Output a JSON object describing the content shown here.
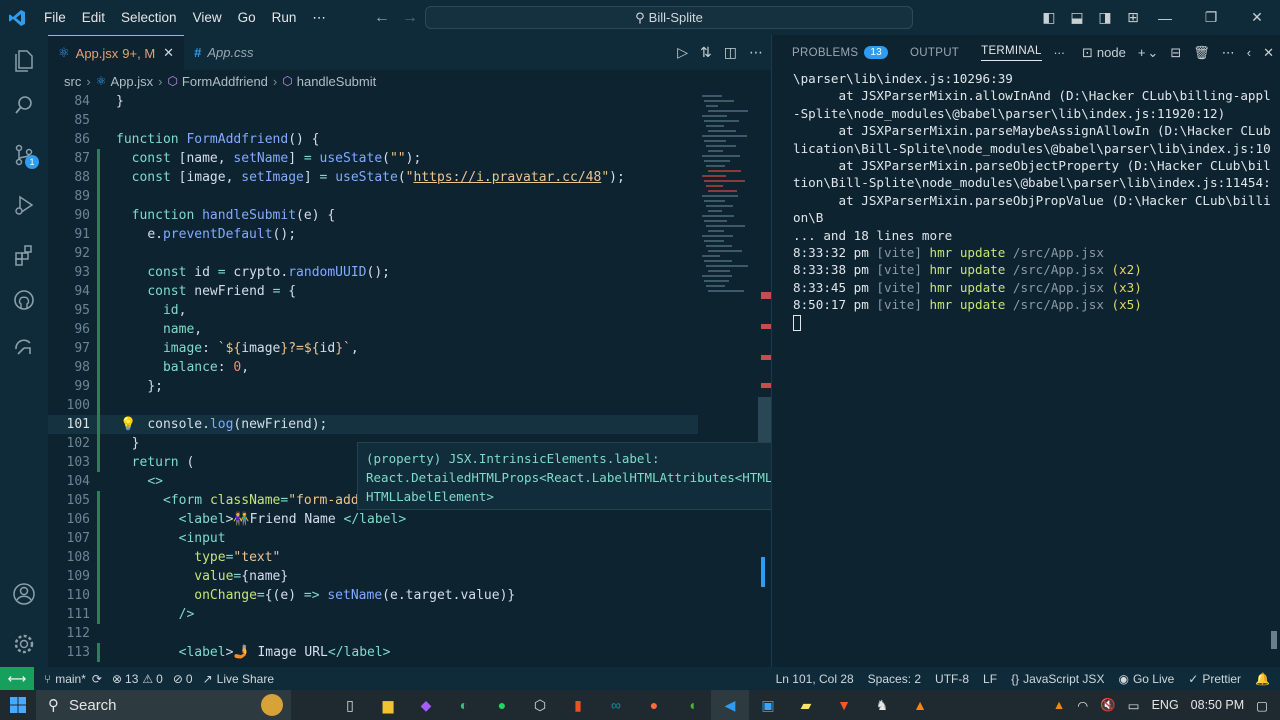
{
  "menu": [
    "File",
    "Edit",
    "Selection",
    "View",
    "Go",
    "Run",
    "⋯"
  ],
  "command_center": "Bill-Splite",
  "activity": {
    "source_control_badge": "1"
  },
  "tabs": [
    {
      "label": "App.jsx",
      "status": "9+, M"
    },
    {
      "label": "App.css"
    }
  ],
  "breadcrumb": [
    "src",
    "App.jsx",
    "FormAddfriend",
    "handleSubmit"
  ],
  "code_lines": [
    {
      "n": "84",
      "html": "<span class='punc'>}</span>"
    },
    {
      "n": "85",
      "html": ""
    },
    {
      "n": "86",
      "html": "<span class='kw'>function</span> <span class='fn'>FormAddfriend</span><span class='punc'>() {</span>"
    },
    {
      "n": "87",
      "html": "  <span class='kw'>const</span> <span class='punc'>[</span><span class='var'>name</span><span class='punc'>,</span> <span class='fn'>setName</span><span class='punc'>]</span> <span class='kw'>=</span> <span class='fn'>useState</span><span class='punc'>(</span><span class='str'>\"\"</span><span class='punc'>);</span>"
    },
    {
      "n": "88",
      "html": "  <span class='kw'>const</span> <span class='punc'>[</span><span class='var'>image</span><span class='punc'>,</span> <span class='fn'>setImage</span><span class='punc'>]</span> <span class='kw'>=</span> <span class='fn'>useState</span><span class='punc'>(</span><span class='str'>\"<u>https://i.pravatar.cc/48</u>\"</span><span class='punc'>);</span>"
    },
    {
      "n": "89",
      "html": ""
    },
    {
      "n": "90",
      "html": "  <span class='kw'>function</span> <span class='fn'>handleSubmit</span><span class='punc'>(</span><span class='var'>e</span><span class='punc'>) {</span>"
    },
    {
      "n": "91",
      "html": "    <span class='var'>e</span><span class='punc'>.</span><span class='fn'>preventDefault</span><span class='punc'>();</span>"
    },
    {
      "n": "92",
      "html": ""
    },
    {
      "n": "93",
      "html": "    <span class='kw'>const</span> <span class='var'>id</span> <span class='kw'>=</span> <span class='var'>crypto</span><span class='punc'>.</span><span class='fn'>randomUUID</span><span class='punc'>();</span>"
    },
    {
      "n": "94",
      "html": "    <span class='kw'>const</span> <span class='var'>newFriend</span> <span class='kw'>=</span> <span class='punc'>{</span>"
    },
    {
      "n": "95",
      "html": "      <span class='prop'>id</span><span class='punc'>,</span>"
    },
    {
      "n": "96",
      "html": "      <span class='prop'>name</span><span class='punc'>,</span>"
    },
    {
      "n": "97",
      "html": "      <span class='prop'>image</span><span class='punc'>:</span> <span class='tmpl'>`${</span><span class='var'>image</span><span class='tmpl'>}?=${</span><span class='var'>id</span><span class='tmpl'>}`</span><span class='punc'>,</span>"
    },
    {
      "n": "98",
      "html": "      <span class='prop'>balance</span><span class='punc'>:</span> <span class='num'>0</span><span class='punc'>,</span>"
    },
    {
      "n": "99",
      "html": "    <span class='punc'>};</span>"
    },
    {
      "n": "100",
      "html": ""
    },
    {
      "n": "101",
      "html": "    <span class='var'>console</span><span class='punc'>.</span><span class='fn'>log</span><span class='punc'>(</span><span class='var'>newFriend</span><span class='punc'>);</span>"
    },
    {
      "n": "102",
      "html": "  <span class='punc'>}</span>"
    },
    {
      "n": "103",
      "html": "  <span class='kw'>return</span> <span class='punc'>(</span>"
    },
    {
      "n": "104",
      "html": "    <span class='tag'>&lt;&gt;</span>"
    },
    {
      "n": "105",
      "html": "      <span class='tag'>&lt;form</span> <span class='attr'>className</span><span class='kw'>=</span><span class='str'>\"form-add</span>"
    },
    {
      "n": "106",
      "html": "        <span class='tag'>&lt;label</span><span class='punc'>&gt;</span>👫<span class='var'>Friend Name </span><span class='tag'>&lt;/label&gt;</span>"
    },
    {
      "n": "107",
      "html": "        <span class='tag'>&lt;input</span>"
    },
    {
      "n": "108",
      "html": "          <span class='attr'>type</span><span class='kw'>=</span><span class='str'>\"text\"</span>"
    },
    {
      "n": "109",
      "html": "          <span class='attr'>value</span><span class='kw'>=</span><span class='punc'>{</span><span class='var'>name</span><span class='punc'>}</span>"
    },
    {
      "n": "110",
      "html": "          <span class='attr'>onChange</span><span class='kw'>=</span><span class='punc'>{(</span><span class='var'>e</span><span class='punc'>)</span> <span class='kw'>=&gt;</span> <span class='fn'>setName</span><span class='punc'>(</span><span class='var'>e</span><span class='punc'>.</span><span class='var'>target</span><span class='punc'>.</span><span class='var'>value</span><span class='punc'>)}</span>"
    },
    {
      "n": "111",
      "html": "        <span class='tag'>/&gt;</span>"
    },
    {
      "n": "112",
      "html": ""
    },
    {
      "n": "113",
      "html": "        <span class='tag'>&lt;label</span><span class='punc'>&gt;</span>🤳 <span class='var'>Image URL</span><span class='tag'>&lt;/label&gt;</span>"
    }
  ],
  "hover": {
    "line1": "(property) JSX.IntrinsicElements.label:",
    "line2": "React.DetailedHTMLProps<React.LabelHTMLAttributes<HTMLLabelEleme",
    "line3": "HTMLLabelElement>"
  },
  "panel": {
    "tabs": [
      "PROBLEMS",
      "OUTPUT",
      "TERMINAL"
    ],
    "problems_count": "13",
    "terminal_name": "node"
  },
  "terminal_lines": [
    {
      "html": "\\parser\\lib\\index.js:10296:39"
    },
    {
      "html": "      at JSXParserMixin.allowInAnd (D:\\Hacker CLub\\billing-appl"
    },
    {
      "html": "-Splite\\node_modules\\@babel\\parser\\lib\\index.js:11920:12)"
    },
    {
      "html": "      at JSXParserMixin.parseMaybeAssignAllowIn (D:\\Hacker CLub"
    },
    {
      "html": "lication\\Bill-Splite\\node_modules\\@babel\\parser\\lib\\index.js:10"
    },
    {
      "html": "      at JSXParserMixin.parseObjectProperty (D:\\Hacker CLub\\bil"
    },
    {
      "html": "tion\\Bill-Splite\\node_modules\\@babel\\parser\\lib\\index.js:11454:"
    },
    {
      "html": "      at JSXParserMixin.parseObjPropValue (D:\\Hacker CLub\\billi"
    },
    {
      "html": "on\\B"
    },
    {
      "html": "... and 18 lines more"
    },
    {
      "html": "8:33:32 pm <span class='dim'>[vite]</span> <span class='green'>hmr update</span> <span class='dim'>/src/App.jsx</span>"
    },
    {
      "html": "8:33:38 pm <span class='dim'>[vite]</span> <span class='green'>hmr update</span> <span class='dim'>/src/App.jsx</span> <span class='yellow'>(x2)</span>"
    },
    {
      "html": "8:33:45 pm <span class='dim'>[vite]</span> <span class='green'>hmr update</span> <span class='dim'>/src/App.jsx</span> <span class='yellow'>(x3)</span>"
    },
    {
      "html": "8:50:17 pm <span class='dim'>[vite]</span> <span class='green'>hmr update</span> <span class='dim'>/src/App.jsx</span> <span class='yellow'>(x5)</span>"
    }
  ],
  "status": {
    "branch": "main*",
    "errors": "13",
    "warnings": "0",
    "ports": "0",
    "live_share": "Live Share",
    "position": "Ln 101, Col 28",
    "spaces": "Spaces: 2",
    "encoding": "UTF-8",
    "eol": "LF",
    "language": "JavaScript JSX",
    "go_live": "Go Live",
    "prettier": "Prettier"
  },
  "taskbar": {
    "search": "Search",
    "lang": "ENG",
    "time": "08:50 PM"
  },
  "colors": {
    "accent": "#2f9cf0",
    "remote": "#17a05d",
    "active_tab": "#e6a178"
  }
}
